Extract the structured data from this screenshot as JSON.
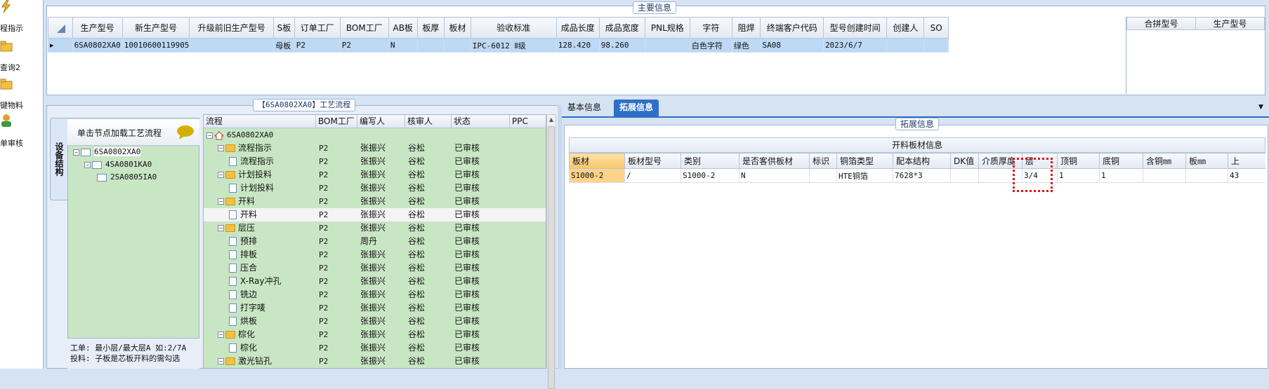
{
  "nav": {
    "items": [
      {
        "label": "程指示"
      },
      {
        "label": "查询2"
      },
      {
        "label": "键物料"
      },
      {
        "label": "单审核"
      }
    ]
  },
  "main_info": {
    "title": "主要信息",
    "columns": [
      "生产型号",
      "新生产型号",
      "升级前旧生产型号",
      "S板",
      "订单工厂",
      "BOM工厂",
      "AB板",
      "板厚",
      "板材",
      "验收标准",
      "成品长度",
      "成品宽度",
      "PNL规格",
      "字符",
      "阻焊",
      "终端客户代码",
      "型号创建时间",
      "创建人",
      "SO"
    ],
    "row": [
      "6SA0802XA0",
      "10010600119905",
      "",
      "母板",
      "P2",
      "P2",
      "N",
      "",
      "",
      "IPC-6012 Ⅱ级",
      "128.420",
      "98.260",
      "",
      "白色字符",
      "绿色",
      "SA08",
      "2023/6/7",
      "",
      ""
    ],
    "side_columns": [
      "合拼型号",
      "生产型号"
    ]
  },
  "process": {
    "title": "【6SA0802XA0】工艺流程",
    "side_tab": "设备结构",
    "hint": "单击节点加载工艺流程",
    "models": [
      "6SA0802XA0",
      "4SA0801KA0",
      "2SA0805IA0"
    ],
    "footer_line1": "工单: 最小层/最大层A 如:2/7A",
    "footer_line2": "投料: 子板是芯板开料的需勾选",
    "columns": [
      "流程",
      "BOM工厂",
      "编写人",
      "核审人",
      "状态",
      "PPC"
    ],
    "root": "6SA0802XA0",
    "rows": [
      {
        "name": "流程指示",
        "type": "folder",
        "factory": "P2",
        "writer": "张振兴",
        "reviewer": "谷松",
        "status": "已审核"
      },
      {
        "name": "流程指示",
        "type": "doc",
        "factory": "P2",
        "writer": "张振兴",
        "reviewer": "谷松",
        "status": "已审核"
      },
      {
        "name": "计划投料",
        "type": "folder",
        "factory": "P2",
        "writer": "张振兴",
        "reviewer": "谷松",
        "status": "已审核"
      },
      {
        "name": "计划投料",
        "type": "doc",
        "factory": "P2",
        "writer": "张振兴",
        "reviewer": "谷松",
        "status": "已审核"
      },
      {
        "name": "开料",
        "type": "folder",
        "factory": "P2",
        "writer": "张振兴",
        "reviewer": "谷松",
        "status": "已审核"
      },
      {
        "name": "开料",
        "type": "doc",
        "factory": "P2",
        "writer": "张振兴",
        "reviewer": "谷松",
        "status": "已审核"
      },
      {
        "name": "层压",
        "type": "folder",
        "factory": "P2",
        "writer": "张振兴",
        "reviewer": "谷松",
        "status": "已审核"
      },
      {
        "name": "预排",
        "type": "doc",
        "factory": "P2",
        "writer": "周丹",
        "reviewer": "谷松",
        "status": "已审核"
      },
      {
        "name": "排板",
        "type": "doc",
        "factory": "P2",
        "writer": "张振兴",
        "reviewer": "谷松",
        "status": "已审核"
      },
      {
        "name": "压合",
        "type": "doc",
        "factory": "P2",
        "writer": "张振兴",
        "reviewer": "谷松",
        "status": "已审核"
      },
      {
        "name": "X-Ray冲孔",
        "type": "doc",
        "factory": "P2",
        "writer": "张振兴",
        "reviewer": "谷松",
        "status": "已审核"
      },
      {
        "name": "铣边",
        "type": "doc",
        "factory": "P2",
        "writer": "张振兴",
        "reviewer": "谷松",
        "status": "已审核"
      },
      {
        "name": "打字唛",
        "type": "doc",
        "factory": "P2",
        "writer": "张振兴",
        "reviewer": "谷松",
        "status": "已审核"
      },
      {
        "name": "烘板",
        "type": "doc",
        "factory": "P2",
        "writer": "张振兴",
        "reviewer": "谷松",
        "status": "已审核"
      },
      {
        "name": "棕化",
        "type": "folder",
        "factory": "P2",
        "writer": "张振兴",
        "reviewer": "谷松",
        "status": "已审核"
      },
      {
        "name": "棕化",
        "type": "doc",
        "factory": "P2",
        "writer": "张振兴",
        "reviewer": "谷松",
        "status": "已审核"
      },
      {
        "name": "激光钻孔",
        "type": "folder",
        "factory": "P2",
        "writer": "张振兴",
        "reviewer": "谷松",
        "status": "已审核"
      }
    ]
  },
  "tabs": {
    "basic": "基本信息",
    "ext": "拓展信息"
  },
  "ext": {
    "title": "拓展信息",
    "table_title": "开料板材信息",
    "columns": [
      "板材",
      "板材型号",
      "类别",
      "是否客供板材",
      "标识",
      "铜箔类型",
      "配本结构",
      "DK值",
      "介质厚度",
      "层",
      "顶铜",
      "底铜",
      "含铜㎜",
      "板㎜",
      "上"
    ],
    "row": [
      "S1000-2",
      "/",
      "S1000-2",
      "N",
      "",
      "HTE铜箔",
      "7628*3",
      "",
      "",
      "3/4",
      "1",
      "1",
      "",
      "",
      "43"
    ]
  },
  "colors": {
    "accent": "#2f6fc5",
    "tree_bg": "#c9e6c4",
    "selected_row": "#bcd9f5",
    "highlight_cell": "#ffd38a"
  }
}
